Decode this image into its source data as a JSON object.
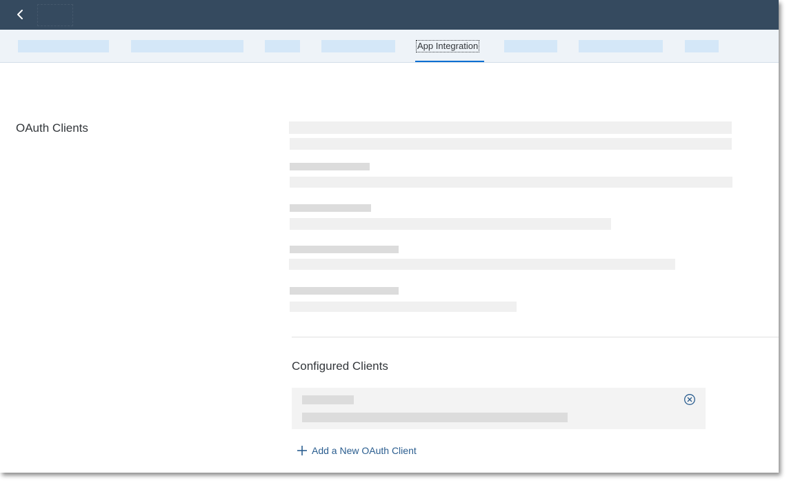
{
  "header": {
    "back_icon": "chevron-left-icon"
  },
  "tabs": {
    "active_label": "App Integration"
  },
  "oauth": {
    "section_title": "OAuth Clients",
    "configured_title": "Configured Clients",
    "remove_icon": "circle-x-icon",
    "add_icon": "plus-icon",
    "add_label": "Add a New OAuth Client"
  },
  "colors": {
    "shell": "#354a5f",
    "tabbar": "#eef3f8",
    "accent": "#0a6ed1",
    "link": "#2a5d8f",
    "placeholder_light": "#f0f0f0",
    "placeholder_dark": "#dcdcdc"
  }
}
